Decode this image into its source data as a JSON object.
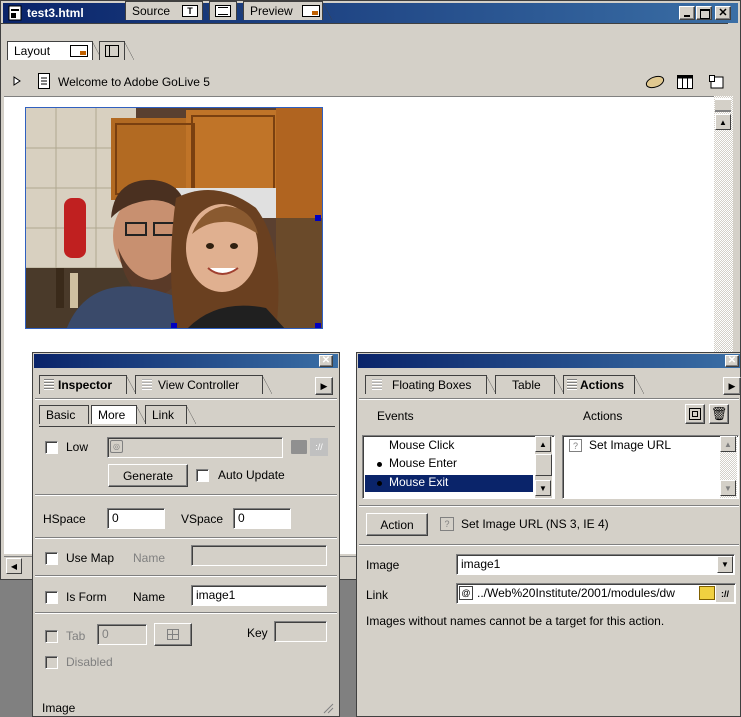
{
  "document_window": {
    "title": "test3.html",
    "tabs": [
      "Layout",
      "Source",
      "Preview"
    ],
    "page_title": "Welcome to Adobe GoLive 5"
  },
  "photo": {
    "description_icon": "photo-image"
  },
  "inspector": {
    "tabs": [
      "Inspector",
      "View Controller"
    ],
    "subtabs": [
      "Basic",
      "More",
      "Link"
    ],
    "low_label": "Low",
    "generate_label": "Generate",
    "auto_update_label": "Auto Update",
    "hspace_label": "HSpace",
    "hspace_value": "0",
    "vspace_label": "VSpace",
    "vspace_value": "0",
    "use_map_label": "Use Map",
    "map_name_label": "Name",
    "is_form_label": "Is Form",
    "form_name_label": "Name",
    "form_name_value": "image1",
    "tab_label": "Tab",
    "tab_value": "0",
    "key_label": "Key",
    "disabled_label": "Disabled",
    "status": "Image"
  },
  "actions_palette": {
    "tabs": [
      "Floating Boxes",
      "Table",
      "Actions"
    ],
    "events_header": "Events",
    "actions_header": "Actions",
    "events": [
      "Mouse Click",
      "Mouse Enter",
      "Mouse Exit"
    ],
    "actions": [
      "Set Image URL"
    ],
    "action_button": "Action",
    "action_description": "Set Image URL (NS 3, IE 4)",
    "image_label": "Image",
    "image_value": "image1",
    "link_label": "Link",
    "link_value": "../Web%20Institute/2001/modules/dw",
    "note": "Images without names cannot be a target for this action."
  },
  "colors": {
    "titlebar": "#0a246a",
    "selection": "#0a246a",
    "face": "#d4d0c8"
  }
}
